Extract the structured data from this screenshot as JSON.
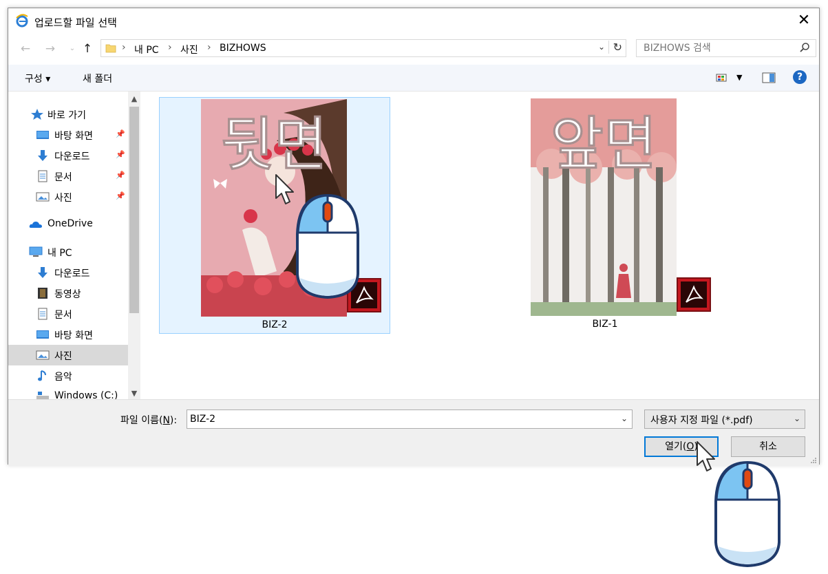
{
  "window": {
    "title": "업로드할 파일 선택",
    "close_glyph": "✕"
  },
  "address": {
    "breadcrumbs": [
      "내 PC",
      "사진",
      "BIZHOWS"
    ],
    "separator": "›"
  },
  "search": {
    "placeholder": "BIZHOWS 검색"
  },
  "toolbar": {
    "organize": "구성 ▾",
    "new_folder": "새 폴더",
    "help": "?"
  },
  "sidebar": {
    "items": [
      {
        "label": "바로 가기",
        "icon": "star-icon"
      },
      {
        "label": "바탕 화면",
        "icon": "desktop-icon",
        "pinned": true
      },
      {
        "label": "다운로드",
        "icon": "download-icon",
        "pinned": true
      },
      {
        "label": "문서",
        "icon": "document-icon",
        "pinned": true
      },
      {
        "label": "사진",
        "icon": "pictures-icon",
        "pinned": true
      },
      {
        "label": "OneDrive",
        "icon": "onedrive-icon"
      },
      {
        "label": "내 PC",
        "icon": "computer-icon"
      },
      {
        "label": "다운로드",
        "icon": "download-icon"
      },
      {
        "label": "동영상",
        "icon": "video-icon"
      },
      {
        "label": "문서",
        "icon": "document-icon"
      },
      {
        "label": "바탕 화면",
        "icon": "desktop-icon"
      },
      {
        "label": "사진",
        "icon": "pictures-icon",
        "selected": true
      },
      {
        "label": "음악",
        "icon": "music-icon"
      },
      {
        "label": "Windows (C:)",
        "icon": "drive-icon"
      }
    ]
  },
  "files": [
    {
      "name": "BIZ-2",
      "thumb_text": "뒷면",
      "selected": true
    },
    {
      "name": "BIZ-1",
      "thumb_text": "앞면",
      "selected": false
    }
  ],
  "bottom": {
    "filename_label": "파일 이름(",
    "filename_accel": "N",
    "filename_label_end": "):",
    "filename_value": "BIZ-2",
    "filetype_value": "사용자 지정 파일 (*.pdf)",
    "open_label": "열기(",
    "open_accel": "O",
    "open_label_end": ")",
    "cancel_label": "취소"
  },
  "colors": {
    "accent": "#0078d7",
    "selection": "#e5f3ff",
    "pdf_red": "#c4181f",
    "mouse_blue": "#7cc4f2",
    "mouse_outline": "#1f3a6b"
  }
}
